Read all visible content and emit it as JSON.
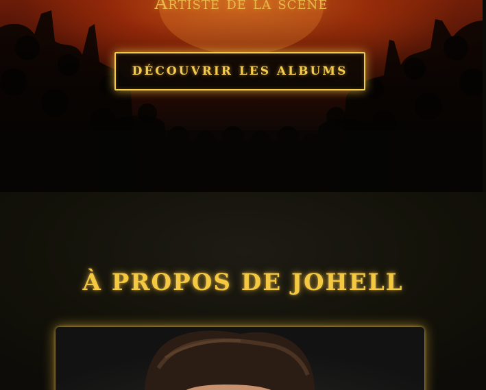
{
  "hero": {
    "subtitle": "Artiste de la scène",
    "cta_label": "DÉCOUVRIR LES ALBUMS"
  },
  "about": {
    "title": "À PROPOS DE JOHELL"
  },
  "colors": {
    "accent_gold": "#f5c842",
    "hero_red": "#6b1c08",
    "background": "#0d0c08"
  }
}
